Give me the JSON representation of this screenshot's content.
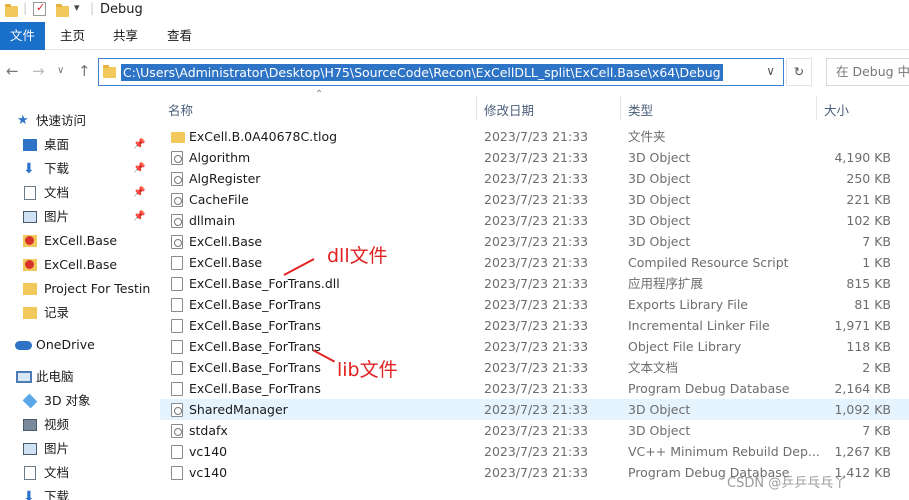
{
  "window": {
    "title": "Debug"
  },
  "ribbon": {
    "tabs": [
      "文件",
      "主页",
      "共享",
      "查看"
    ]
  },
  "address": {
    "path": "C:\\Users\\Administrator\\Desktop\\H75\\SourceCode\\Recon\\ExCellDLL_split\\ExCell.Base\\x64\\Debug",
    "search_placeholder": "在 Debug 中搜"
  },
  "nav": {
    "items": [
      {
        "label": "快速访问",
        "icon": "star-icon"
      },
      {
        "label": "桌面",
        "icon": "desktop-icon",
        "pinned": true
      },
      {
        "label": "下载",
        "icon": "download-icon",
        "pinned": true
      },
      {
        "label": "文档",
        "icon": "document-icon",
        "pinned": true
      },
      {
        "label": "图片",
        "icon": "picture-icon",
        "pinned": true
      },
      {
        "label": "ExCell.Base",
        "icon": "folder-warning-icon"
      },
      {
        "label": "ExCell.Base",
        "icon": "folder-warning-icon"
      },
      {
        "label": "Project For Testing",
        "icon": "folder-icon"
      },
      {
        "label": "记录",
        "icon": "folder-icon"
      },
      {
        "label": "OneDrive",
        "icon": "cloud-icon"
      },
      {
        "label": "此电脑",
        "icon": "computer-icon"
      },
      {
        "label": "3D 对象",
        "icon": "cube-icon"
      },
      {
        "label": "视频",
        "icon": "video-icon"
      },
      {
        "label": "图片",
        "icon": "picture-icon"
      },
      {
        "label": "文档",
        "icon": "document-icon"
      },
      {
        "label": "下载",
        "icon": "download-icon"
      }
    ]
  },
  "columns": {
    "name": "名称",
    "date": "修改日期",
    "type": "类型",
    "size": "大小"
  },
  "files": [
    {
      "name": "ExCell.B.0A40678C.tlog",
      "date": "2023/7/23 21:33",
      "type": "文件夹",
      "size": "",
      "icon": "folder-icon"
    },
    {
      "name": "Algorithm",
      "date": "2023/7/23 21:33",
      "type": "3D Object",
      "size": "4,190 KB",
      "icon": "gear-file-icon"
    },
    {
      "name": "AlgRegister",
      "date": "2023/7/23 21:33",
      "type": "3D Object",
      "size": "250 KB",
      "icon": "gear-file-icon"
    },
    {
      "name": "CacheFile",
      "date": "2023/7/23 21:33",
      "type": "3D Object",
      "size": "221 KB",
      "icon": "gear-file-icon"
    },
    {
      "name": "dllmain",
      "date": "2023/7/23 21:33",
      "type": "3D Object",
      "size": "102 KB",
      "icon": "gear-file-icon"
    },
    {
      "name": "ExCell.Base",
      "date": "2023/7/23 21:33",
      "type": "3D Object",
      "size": "7 KB",
      "icon": "gear-file-icon"
    },
    {
      "name": "ExCell.Base",
      "date": "2023/7/23 21:33",
      "type": "Compiled Resource Script",
      "size": "1 KB",
      "icon": "resource-file-icon"
    },
    {
      "name": "ExCell.Base_ForTrans.dll",
      "date": "2023/7/23 21:33",
      "type": "应用程序扩展",
      "size": "815 KB",
      "icon": "dll-file-icon"
    },
    {
      "name": "ExCell.Base_ForTrans",
      "date": "2023/7/23 21:33",
      "type": "Exports Library File",
      "size": "81 KB",
      "icon": "gears-icon"
    },
    {
      "name": "ExCell.Base_ForTrans",
      "date": "2023/7/23 21:33",
      "type": "Incremental Linker File",
      "size": "1,971 KB",
      "icon": "linker-file-icon"
    },
    {
      "name": "ExCell.Base_ForTrans",
      "date": "2023/7/23 21:33",
      "type": "Object File Library",
      "size": "118 KB",
      "icon": "library-file-icon"
    },
    {
      "name": "ExCell.Base_ForTrans",
      "date": "2023/7/23 21:33",
      "type": "文本文档",
      "size": "2 KB",
      "icon": "text-file-icon"
    },
    {
      "name": "ExCell.Base_ForTrans",
      "date": "2023/7/23 21:33",
      "type": "Program Debug Database",
      "size": "2,164 KB",
      "icon": "pdb-file-icon"
    },
    {
      "name": "SharedManager",
      "date": "2023/7/23 21:33",
      "type": "3D Object",
      "size": "1,092 KB",
      "icon": "gear-file-icon",
      "selected": true
    },
    {
      "name": "stdafx",
      "date": "2023/7/23 21:33",
      "type": "3D Object",
      "size": "7 KB",
      "icon": "gear-file-icon"
    },
    {
      "name": "vc140",
      "date": "2023/7/23 21:33",
      "type": "VC++ Minimum Rebuild Dep...",
      "size": "1,267 KB",
      "icon": "idb-file-icon"
    },
    {
      "name": "vc140",
      "date": "2023/7/23 21:33",
      "type": "Program Debug Database",
      "size": "1,412 KB",
      "icon": "pdb-file-icon"
    }
  ],
  "annotations": {
    "dll": "dll文件",
    "lib": "lib文件"
  },
  "watermark": "CSDN @乒乒乓乓丫"
}
